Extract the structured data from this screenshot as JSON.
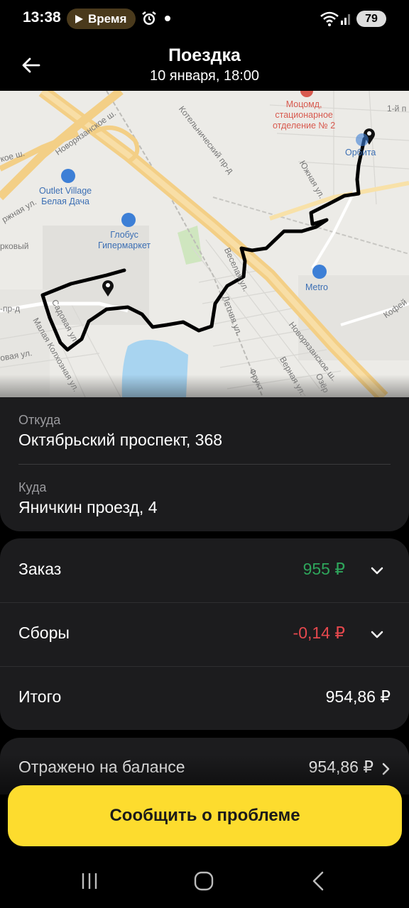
{
  "status_bar": {
    "time": "13:38",
    "pill_label": "Время",
    "battery": "79",
    "icons": [
      "play-icon",
      "alarm-icon",
      "dot-icon",
      "wifi-icon",
      "signal-icon",
      "battery-icon"
    ]
  },
  "header": {
    "title": "Поездка",
    "subtitle": "10 января, 18:00",
    "back_icon": "arrow-left-icon"
  },
  "map": {
    "labels": {
      "novoryazan_top": "Новорязанское ш.",
      "kotelniki": "Котельнический пр-д",
      "yuzhnaya": "Южная ул.",
      "veselaya": "Веселая ул.",
      "letnyaya": "Летняя ул.",
      "novoryazan_bottom": "Новорязанское ш.",
      "sadovaya": "Садовая ул.",
      "malaya_kolkhoznaya": "Малая Колхозная ул.",
      "kofeynaya": "Кофей",
      "fruktovaya": "Фрукт",
      "vernaya": "Верная ул.",
      "ozernaya": "Озёр",
      "ul1": "1-й п",
      "koe_sh": "кое ш.",
      "rozhnaya": "ржная ул.",
      "kovy": "рковый",
      "pr_d": "-пр-д",
      "sadovaya2": "ул.",
      "ovaya": "овая ул."
    },
    "poi": {
      "outlet": "Outlet Village\nБелая Дача",
      "globus": "Глобус\nГипермаркет",
      "metro": "Metro",
      "orbita": "Орбита",
      "hospital": "Моцомд,\nстационарное\nотделение № 2"
    },
    "accent_route": "#000000"
  },
  "trip": {
    "from_label": "Откуда",
    "from_value": "Октябрьский проспект, 368",
    "to_label": "Куда",
    "to_value": "Яничкин проезд, 4"
  },
  "price": {
    "order_label": "Заказ",
    "order_value": "955 ₽",
    "order_color": "#2ea55b",
    "fees_label": "Сборы",
    "fees_value": "-0,14 ₽",
    "fees_color": "#e5484d",
    "total_label": "Итого",
    "total_value": "954,86 ₽"
  },
  "balance": {
    "label": "Отражено на балансе",
    "value": "954,86 ₽"
  },
  "actions": {
    "report_label": "Сообщить о проблеме",
    "accent": "#fddc2e"
  },
  "nav": {
    "recent_icon": "recent-apps-icon",
    "home_icon": "home-icon",
    "back_icon": "back-icon"
  }
}
